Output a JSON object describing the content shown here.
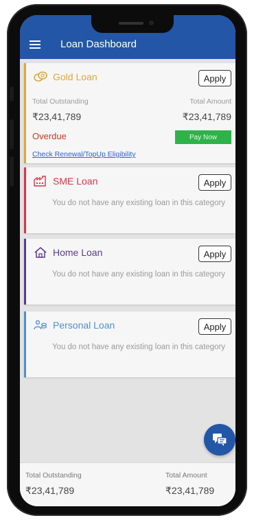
{
  "appbar": {
    "title": "Loan Dashboard",
    "bg_color": "#2356a6"
  },
  "cards": {
    "gold": {
      "title": "Gold Loan",
      "icon": "coins-icon",
      "accent": "#d9a93a",
      "apply_label": "Apply",
      "total_outstanding_label": "Total Outstanding",
      "total_outstanding_value": "₹23,41,789",
      "total_amount_label": "Total Amount",
      "total_amount_value": "₹23,41,789",
      "status": "Overdue",
      "pay_label": "Pay Now",
      "renewal_link": "Check Renewal/TopUp Eligibility"
    },
    "sme": {
      "title": "SME Loan",
      "icon": "factory-icon",
      "accent": "#d9344a",
      "apply_label": "Apply",
      "message": "You do not have any existing loan in this category"
    },
    "home": {
      "title": "Home Loan",
      "icon": "house-icon",
      "accent": "#5a3a8c",
      "apply_label": "Apply",
      "message": "You do not have any existing loan in this category"
    },
    "personal": {
      "title": "Personal Loan",
      "icon": "person-coins-icon",
      "accent": "#4f8fd0",
      "apply_label": "Apply",
      "message": "You do not have any existing loan in this category"
    }
  },
  "footer": {
    "total_outstanding_label": "Total Outstanding",
    "total_outstanding_value": "₹23,41,789",
    "total_amount_label": "Total Amount",
    "total_amount_value": "₹23,41,789"
  },
  "fab": {
    "icon": "chat-icon"
  }
}
